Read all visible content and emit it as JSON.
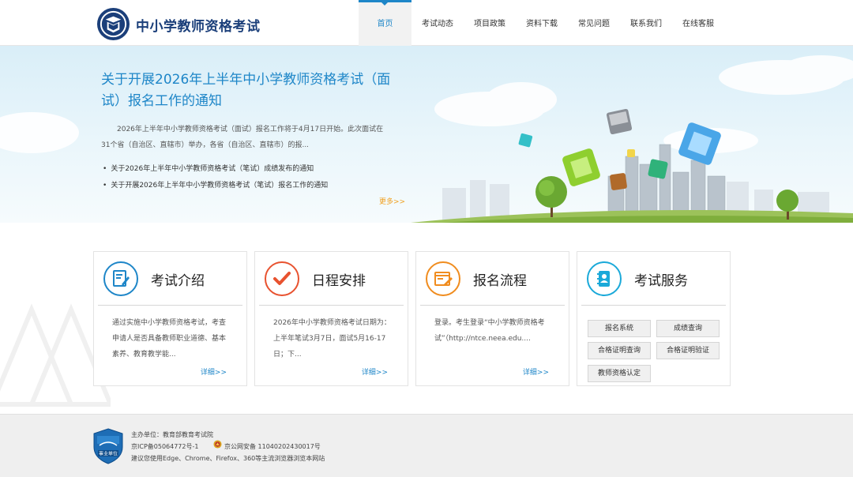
{
  "header": {
    "site_title": "中小学教师资格考试",
    "nav": [
      {
        "label": "首页",
        "active": true
      },
      {
        "label": "考试动态"
      },
      {
        "label": "项目政策"
      },
      {
        "label": "资料下载"
      },
      {
        "label": "常见问题"
      },
      {
        "label": "联系我们"
      },
      {
        "label": "在线客服"
      }
    ]
  },
  "banner": {
    "title": "关于开展2026年上半年中小学教师资格考试（面试）报名工作的通知",
    "summary": "2026年上半年中小学教师资格考试（面试）报名工作将于4月17日开始。此次面试在31个省（自治区、直辖市）举办，各省（自治区、直辖市）的报...",
    "items": [
      "关于2026年上半年中小学教师资格考试（笔试）成绩发布的通知",
      "关于开展2026年上半年中小学教师资格考试（笔试）报名工作的通知"
    ],
    "more": "更多>>"
  },
  "cards": [
    {
      "title": "考试介绍",
      "text": "通过实施中小学教师资格考试，考查申请人是否具备教师职业道德、基本素养、教育教学能...",
      "more": "详细>>",
      "icon": "document-pen-icon",
      "color": "#1e86c8"
    },
    {
      "title": "日程安排",
      "text": "2026年中小学教师资格考试日期为：上半年笔试3月7日，面试5月16-17日；下...",
      "more": "详细>>",
      "icon": "checkmark-icon",
      "color": "#e8522f"
    },
    {
      "title": "报名流程",
      "text": "登录。考生登录“中小学教师资格考试”（http://ntce.neea.edu....",
      "more": "详细>>",
      "icon": "form-edit-icon",
      "color": "#f08c1e"
    },
    {
      "title": "考试服务",
      "icon": "contact-book-icon",
      "color": "#1aa9d9",
      "buttons": [
        "报名系统",
        "成绩查询",
        "合格证明查询",
        "合格证明验证",
        "教师资格认定"
      ]
    }
  ],
  "footer": {
    "sponsor": "主办单位：教育部教育考试院",
    "icp": "京ICP备05064772号-1",
    "police": "京公网安备 11040202430017号",
    "browser": "建议您使用Edge、Chrome、Firefox、360等主流浏览器浏览本网站",
    "badge_text": "事业单位"
  },
  "colors": {
    "accent": "#1e86c8",
    "title": "#1b3f7a",
    "more": "#f0a020"
  }
}
